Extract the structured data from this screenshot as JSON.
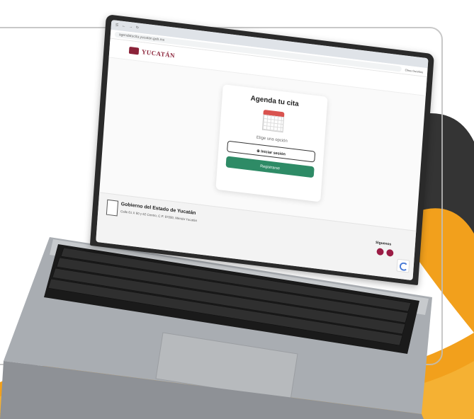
{
  "browser": {
    "url": "agendatucita.yucatan.gob.mx",
    "bookmark_bar": "Otros favoritos"
  },
  "site": {
    "logo_text": "YUCATÁN"
  },
  "card": {
    "title": "Agenda tu cita",
    "choose_label": "Elige una opción",
    "login_button": "Iniciar sesión",
    "register_button": "Registrarse"
  },
  "footer": {
    "org_name": "Gobierno del Estado de Yucatán",
    "address": "Calle 61 X 60 y 62 Centro, C.P. 97000, Mérida Yucatán",
    "follow_label": "Síguenos"
  },
  "colors": {
    "brand": "#8b2339",
    "register_green": "#2e8b66",
    "social_maroon": "#9b1c45",
    "background_orange": "#f2a01c"
  },
  "icons": [
    "calendar-icon",
    "user-icon",
    "social-icon",
    "recaptcha-icon"
  ]
}
